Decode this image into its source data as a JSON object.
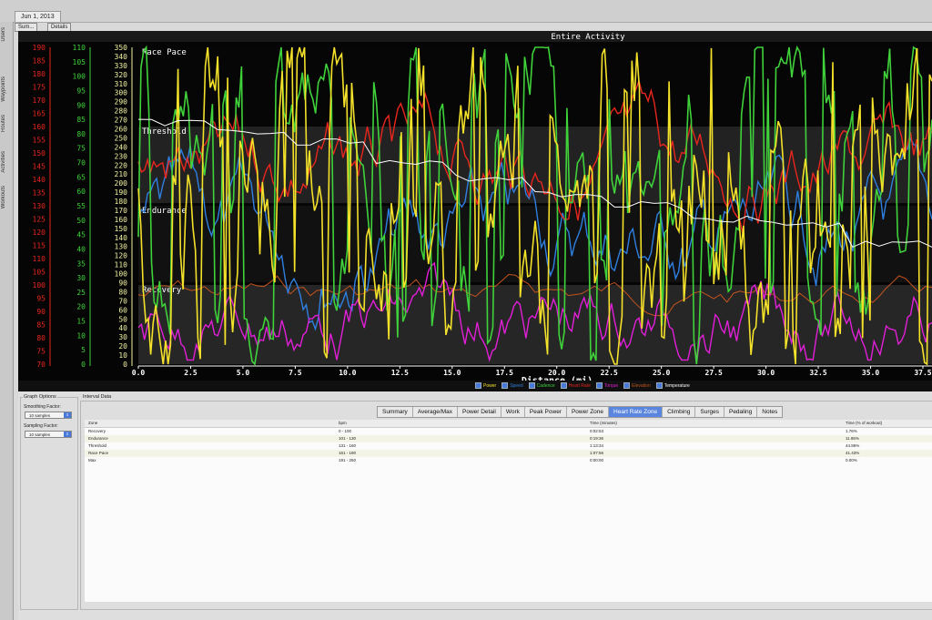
{
  "window": {
    "doc_tab": "Jun 1, 2013"
  },
  "sidebar": {
    "items": [
      "Users",
      "Waypoints",
      "Routes",
      "Activities",
      "Workouts"
    ]
  },
  "subtabs": [
    "Sum...",
    "Details"
  ],
  "chart_data": {
    "type": "line",
    "title": "Entire Activity",
    "xlabel": "Distance (mi)",
    "x_ticks": [
      0.0,
      2.5,
      5.0,
      7.5,
      10.0,
      12.5,
      15.0,
      17.5,
      20.0,
      22.5,
      25.0,
      27.5,
      30.0,
      32.5,
      35.0,
      37.5
    ],
    "x_tick_labels": [
      "0.0",
      "2.5",
      "5.0",
      "7.5",
      "10.0",
      "12.5",
      "15.0",
      "17.5",
      "20.0",
      "22.5",
      "25.0",
      "27.5",
      "30.0",
      "32.5",
      "35.0",
      "37.5"
    ],
    "xlim": [
      0,
      37.5
    ],
    "axes": [
      {
        "name": "heart-rate-axis",
        "color": "#e8261d",
        "range": [
          70,
          190
        ],
        "ticks": [
          190,
          185,
          180,
          175,
          170,
          165,
          160,
          155,
          150,
          145,
          140,
          135,
          130,
          125,
          120,
          115,
          110,
          105,
          100,
          95,
          90,
          85,
          80,
          75,
          70
        ]
      },
      {
        "name": "cadence-axis",
        "color": "#3fd23a",
        "range": [
          0,
          110
        ],
        "ticks": [
          110,
          105,
          100,
          95,
          90,
          85,
          80,
          75,
          70,
          65,
          60,
          55,
          50,
          45,
          40,
          35,
          30,
          25,
          20,
          15,
          10,
          5,
          0
        ]
      },
      {
        "name": "power-axis",
        "color": "#f2f2a0",
        "range": [
          0,
          350
        ],
        "ticks": [
          350,
          340,
          330,
          320,
          310,
          300,
          290,
          280,
          270,
          260,
          250,
          240,
          230,
          220,
          210,
          200,
          190,
          180,
          170,
          160,
          150,
          140,
          130,
          120,
          110,
          100,
          90,
          80,
          70,
          60,
          50,
          40,
          30,
          20,
          10,
          0
        ]
      }
    ],
    "zones": [
      {
        "label": "Race Pace",
        "from_bpm": 161,
        "to_bpm": 190
      },
      {
        "label": "Threshold",
        "from_bpm": 131,
        "to_bpm": 160
      },
      {
        "label": "Endurance",
        "from_bpm": 101,
        "to_bpm": 130
      },
      {
        "label": "Recovery",
        "from_bpm": 0,
        "to_bpm": 100
      }
    ],
    "series": [
      {
        "name": "Power",
        "color": "#f4e12a"
      },
      {
        "name": "Speed",
        "color": "#2f7fe0"
      },
      {
        "name": "Cadence",
        "color": "#3fd23a"
      },
      {
        "name": "Heart Rate",
        "color": "#e8261d"
      },
      {
        "name": "Torque",
        "color": "#e21fd8"
      },
      {
        "name": "Elevation",
        "color": "#c5541d"
      },
      {
        "name": "Temperature",
        "color": "#ffffff"
      }
    ]
  },
  "graph_options": {
    "title": "Graph Options",
    "smoothing_label": "Smoothing Factor:",
    "smoothing_value": "10 samples",
    "sampling_label": "Sampling Factor:",
    "sampling_value": "10 samples"
  },
  "interval_data": {
    "title": "Interval Data",
    "tabs": [
      "Summary",
      "Average/Max",
      "Power Detail",
      "Work",
      "Peak Power",
      "Power Zone",
      "Heart Rate Zone",
      "Climbing",
      "Surges",
      "Pedaling",
      "Notes"
    ],
    "active_tab": "Heart Rate Zone",
    "table": {
      "headers": [
        "Zone",
        "bpm",
        "Time (minutes)",
        "Time (% of workout)"
      ],
      "rows": [
        [
          "Recovery",
          "0 - 100",
          "0:02:53",
          "1.76%"
        ],
        [
          "Endurance",
          "101 - 130",
          "0:19:36",
          "11.95%"
        ],
        [
          "Threshold",
          "131 - 160",
          "1:13:34",
          "44.86%"
        ],
        [
          "Race Pace",
          "161 - 190",
          "1:07:56",
          "41.43%"
        ],
        [
          "Max",
          "191 - 250",
          "0:00:00",
          "0.00%"
        ]
      ]
    }
  }
}
